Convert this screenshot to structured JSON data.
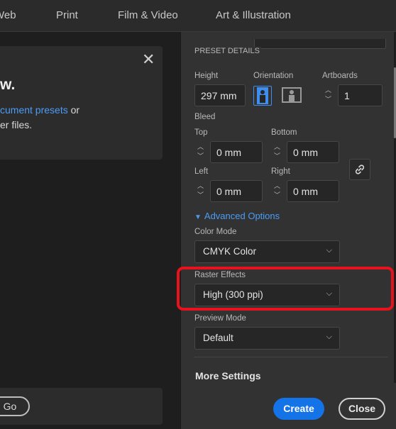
{
  "tabs": [
    {
      "label": "Web"
    },
    {
      "label": "Print"
    },
    {
      "label": "Film & Video"
    },
    {
      "label": "Art & Illustration"
    }
  ],
  "left": {
    "heading": "w.",
    "link_text": "cument presets",
    "after_link": " or",
    "line2": "er files.",
    "go_label": "Go"
  },
  "panel": {
    "section_title": "PRESET DETAILS",
    "height_label": "Height",
    "height_value": "297 mm",
    "orientation_label": "Orientation",
    "artboards_label": "Artboards",
    "artboards_value": "1",
    "bleed_label": "Bleed",
    "top_label": "Top",
    "top_value": "0 mm",
    "bottom_label": "Bottom",
    "bottom_value": "0 mm",
    "left_label": "Left",
    "left_value": "0 mm",
    "right_label": "Right",
    "right_value": "0 mm",
    "advanced_label": "Advanced Options",
    "color_mode_label": "Color Mode",
    "color_mode_value": "CMYK Color",
    "raster_label": "Raster Effects",
    "raster_value": "High (300 ppi)",
    "preview_label": "Preview Mode",
    "preview_value": "Default",
    "more_settings": "More Settings",
    "create_label": "Create",
    "close_label": "Close"
  },
  "colors": {
    "accent": "#1473e6",
    "link": "#4b9cf5",
    "highlight": "#e8121d"
  },
  "icons": {
    "close": "close-icon",
    "portrait": "portrait-orientation-icon",
    "landscape": "landscape-orientation-icon",
    "link": "link-icon",
    "chevron": "chevron-down-icon"
  }
}
